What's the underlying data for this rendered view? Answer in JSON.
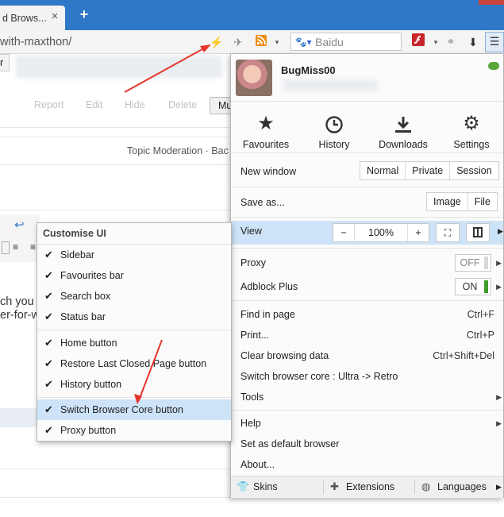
{
  "browser": {
    "tab_title": "d Brows...",
    "tab_close": "×",
    "new_tab": "+",
    "url": "with-maxthon/",
    "search_placeholder": "Baidu"
  },
  "page": {
    "top_left_fragment": "r",
    "post_actions": [
      "Report",
      "Edit",
      "Hide",
      "Delete"
    ],
    "partial_button": "Mu",
    "moderation_link": "Topic Moderation · Bac",
    "text_lines": [
      "ch you c",
      "er-for-w"
    ]
  },
  "menu": {
    "username": "BugMiss00",
    "quick_items": [
      {
        "label": "Favourites",
        "icon": "star-icon"
      },
      {
        "label": "History",
        "icon": "clock-icon"
      },
      {
        "label": "Downloads",
        "icon": "download-icon"
      },
      {
        "label": "Settings",
        "icon": "gear-icon"
      }
    ],
    "new_window": {
      "label": "New window",
      "options": [
        "Normal",
        "Private",
        "Session"
      ]
    },
    "save_as": {
      "label": "Save as...",
      "options": [
        "Image",
        "File"
      ]
    },
    "view": {
      "label": "View",
      "minus": "−",
      "zoom": "100%",
      "plus": "+"
    },
    "proxy": {
      "label": "Proxy",
      "state": "OFF"
    },
    "adblock": {
      "label": "Adblock Plus",
      "state": "ON"
    },
    "actions": [
      {
        "label": "Find in page",
        "shortcut": "Ctrl+F"
      },
      {
        "label": "Print...",
        "shortcut": "Ctrl+P"
      },
      {
        "label": "Clear browsing data",
        "shortcut": "Ctrl+Shift+Del"
      },
      {
        "label": "Switch browser core : Ultra -> Retro",
        "shortcut": ""
      }
    ],
    "tools": "Tools",
    "help": "Help",
    "set_default": "Set as default browser",
    "about": "About...",
    "bottom": {
      "skins": "Skins",
      "extensions": "Extensions",
      "languages": "Languages"
    }
  },
  "customise_ui": {
    "title": "Customise UI",
    "items": [
      {
        "label": "Sidebar",
        "checked": true
      },
      {
        "label": "Favourites bar",
        "checked": true
      },
      {
        "label": "Search box",
        "checked": true
      },
      {
        "label": "Status bar",
        "checked": true
      },
      {
        "label": "Home button",
        "checked": true
      },
      {
        "label": "Restore Last Closed Page button",
        "checked": true
      },
      {
        "label": "History button",
        "checked": true
      },
      {
        "label": "Switch Browser Core button",
        "checked": true,
        "highlighted": true
      },
      {
        "label": "Proxy button",
        "checked": true
      }
    ]
  },
  "colors": {
    "accent": "#2f78c8",
    "highlight": "#cde3f7",
    "annotation_arrow": "#e5352b",
    "toggle_on": "#3f9e2a",
    "lightning": "#f0b400",
    "rss": "#f08a12"
  }
}
